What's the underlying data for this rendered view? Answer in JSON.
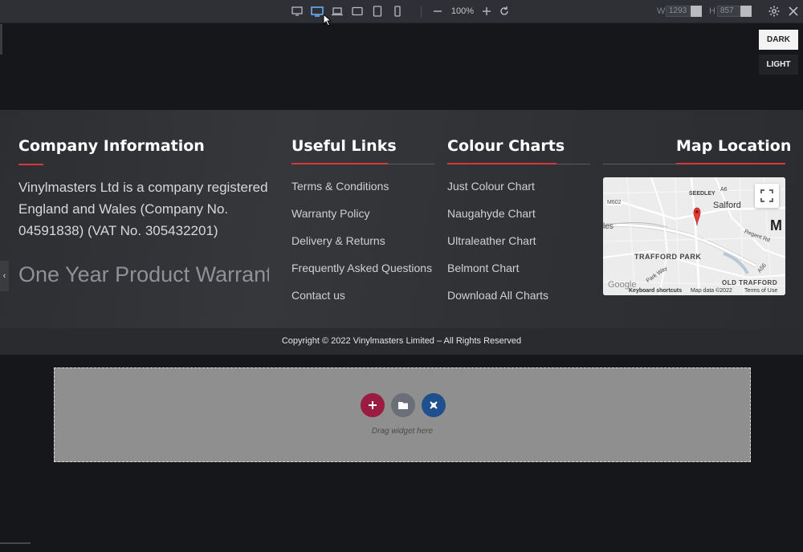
{
  "toolbar": {
    "zoom": "100%",
    "width_label": "W",
    "width_value": "1293",
    "height_label": "H",
    "height_value": "857"
  },
  "mode": {
    "dark": "DARK",
    "light": "LIGHT"
  },
  "footer": {
    "company": {
      "title": "Company Information",
      "text": "Vinylmasters Ltd is a company registered England and Wales (Company No. 04591838) (VAT No. 305432201)",
      "slider_text": "One Year Product Warranty"
    },
    "useful_links": {
      "title": "Useful Links",
      "items": [
        "Terms & Conditions",
        "Warranty Policy",
        "Delivery & Returns",
        "Frequently Asked Questions",
        "Contact us"
      ]
    },
    "colour_charts": {
      "title": "Colour Charts",
      "items": [
        "Just Colour Chart",
        "Naugahyde Chart",
        "Ultraleather Chart",
        "Belmont Chart",
        "Download All Charts"
      ]
    },
    "map": {
      "title": "Map Location",
      "labels": {
        "seedley": "SEEDLEY",
        "salford": "Salford",
        "m602": "M602",
        "a6": "A6",
        "regent_rd": "Regent Rd",
        "les": "les",
        "m": "M",
        "trafford_park": "TRAFFORD PARK",
        "old_trafford": "OLD TRAFFORD",
        "a56": "A56",
        "park_way": "Park Way"
      },
      "google": "Google",
      "shortcuts": "Keyboard shortcuts",
      "map_data": "Map data ©2022",
      "terms": "Terms of Use"
    }
  },
  "copyright": "Copyright © 2022 Vinylmasters Limited – All Rights Reserved",
  "dropzone": {
    "hint": "Drag widget here"
  },
  "colors": {
    "accent_red": "#d7373d",
    "add_button": "#9b1c43",
    "folder_button": "#6b6f77",
    "elementor_button": "#1f4f8f"
  }
}
